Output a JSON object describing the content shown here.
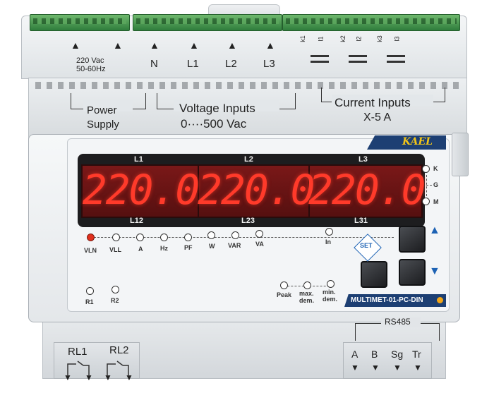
{
  "top_terminals": [
    "220 Vac",
    "50-60Hz",
    "N",
    "L1",
    "L2",
    "L3"
  ],
  "current_terminals": [
    "k1",
    "l1",
    "k2",
    "l2",
    "k3",
    "l3"
  ],
  "groups": {
    "power": [
      "Power",
      "Supply"
    ],
    "voltage": [
      "Voltage Inputs",
      "0····500 Vac"
    ],
    "current": [
      "Current Inputs",
      "X-5 A"
    ]
  },
  "brand": "KAEL",
  "display": {
    "top_labels": [
      "L1",
      "L2",
      "L3"
    ],
    "bottom_labels": [
      "L12",
      "L23",
      "L31"
    ],
    "values": [
      "220.0",
      "220.0",
      "220.0"
    ]
  },
  "phase_indicators": [
    "K",
    "G",
    "M"
  ],
  "indicators": [
    "VLN",
    "VLL",
    "A",
    "Hz",
    "PF",
    "W",
    "VAR",
    "VA",
    "In"
  ],
  "set_label": "SET",
  "demand_indicators": [
    "Peak",
    "max.\ndem.",
    "min.\ndem."
  ],
  "relay_indicators": [
    "R1",
    "R2"
  ],
  "model": "MULTIMET-01-PC-DIN",
  "rs485": {
    "label": "RS485",
    "terminals": [
      "A",
      "B",
      "Sg",
      "Tr"
    ]
  },
  "relays": [
    "RL1",
    "RL2"
  ],
  "colors": {
    "display_digits": "#ff3a2a",
    "brand_bar": "#1d3f73",
    "brand_text": "#f0c419",
    "accent": "#1d62b4",
    "led_on": "#e0301e"
  }
}
